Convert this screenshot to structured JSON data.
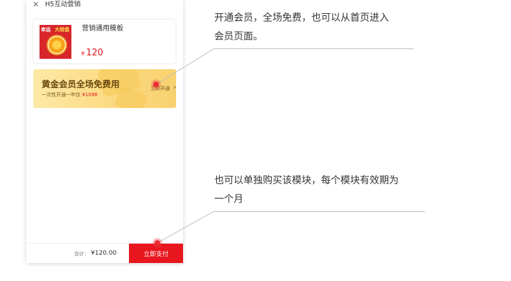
{
  "topbar": {
    "close_icon": "close-icon",
    "title": "H5互动营销"
  },
  "product": {
    "name": "营销通用模板",
    "price_symbol": "¥",
    "price": "120",
    "thumb_text_1": "幸运",
    "thumb_text_2": "大转盘"
  },
  "member_banner": {
    "title": "黄金会员全场免费用",
    "subtitle_prefix": "一次性开通一年仅",
    "subtitle_price": "¥1098",
    "cta": "立即开通",
    "chevron_icon": "chevron-right-icon"
  },
  "footer": {
    "total_label": "合计：",
    "total_value": "¥120.00",
    "pay_button": "立即支付"
  },
  "annotations": {
    "member_line1": "开通会员，全场免费，也可以从首页进入",
    "member_line2": "会员页面。",
    "purchase_line1": "也可以单独购买该模块，每个模块有效期为",
    "purchase_line2": "一个月"
  },
  "colors": {
    "accent_red": "#e8161e",
    "gold_light": "#fde9a6",
    "gold_dark": "#f9d16f",
    "hotspot": "#ec2b35"
  }
}
